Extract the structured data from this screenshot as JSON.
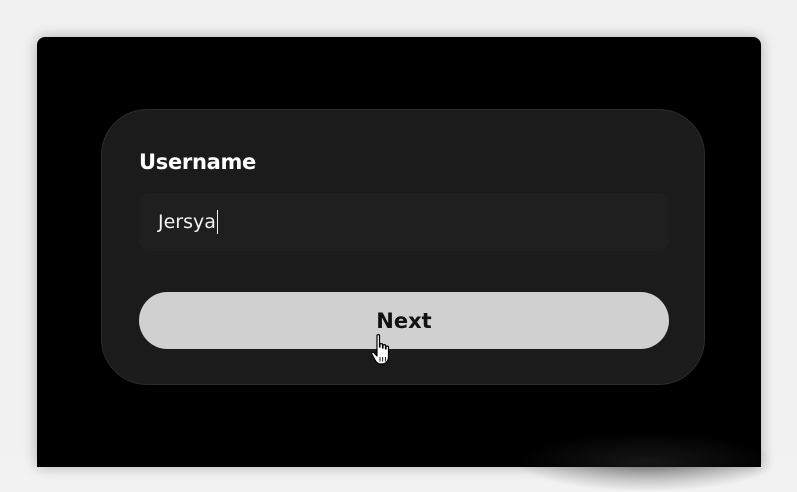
{
  "form": {
    "username_label": "Username",
    "username_value": "Jersya",
    "next_label": "Next"
  },
  "colors": {
    "window_background": "#000000",
    "card_background": "#1b1b1b",
    "input_background": "#1f1f1f",
    "button_background": "#d0d0d0",
    "button_text": "#111111",
    "label_text": "#ffffff"
  },
  "icons": {
    "pointer": "hand-pointer-icon"
  }
}
